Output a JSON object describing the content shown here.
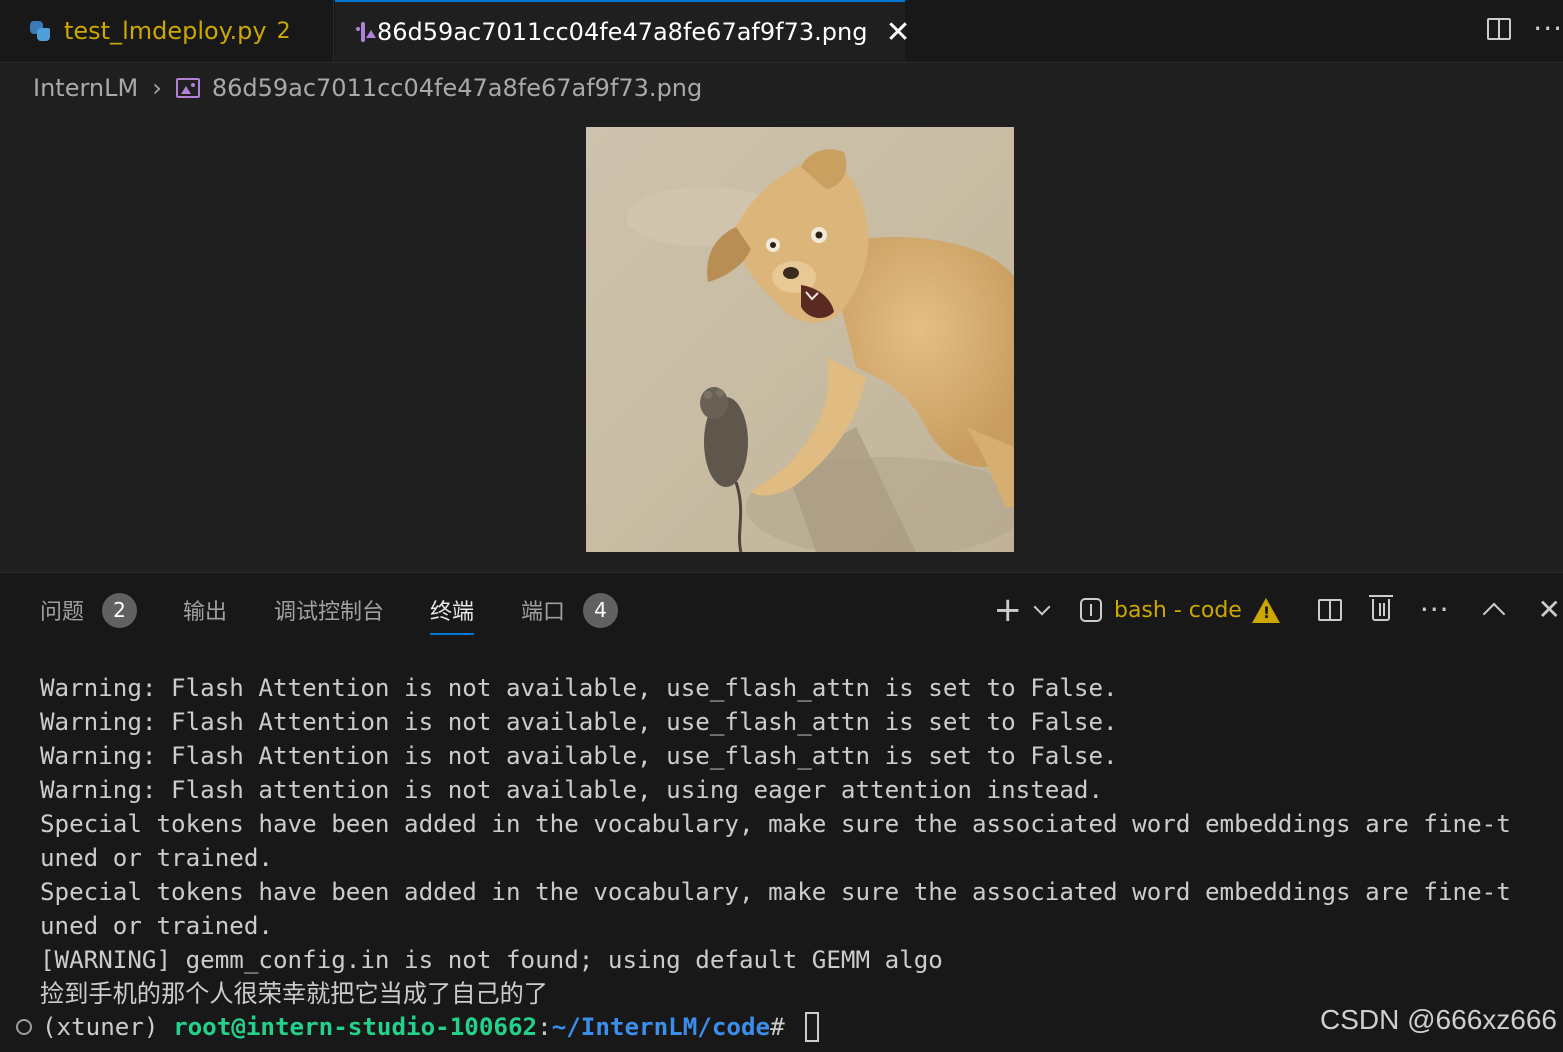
{
  "tabs": [
    {
      "label": "test_lmdeploy.py",
      "count": "2",
      "icon": "python-icon"
    },
    {
      "label": "86d59ac7011cc04fe47a8fe67af9f73.png",
      "icon": "image-icon"
    }
  ],
  "tab_close": "✕",
  "breadcrumb": {
    "folder": "InternLM",
    "file": "86d59ac7011cc04fe47a8fe67af9f73.png"
  },
  "preview": {
    "description_icon": "image-preview",
    "colors": {
      "sand": "#cbbfa6",
      "dog": "#d9b173",
      "rat": "#5e554b"
    }
  },
  "panel": {
    "tabs": [
      {
        "label": "问题",
        "badge": "2"
      },
      {
        "label": "输出"
      },
      {
        "label": "调试控制台"
      },
      {
        "label": "终端",
        "active": true
      },
      {
        "label": "端口",
        "badge": "4"
      }
    ],
    "terminal_name": "bash - code",
    "plus": "+",
    "more": "···",
    "close": "✕"
  },
  "terminal": {
    "lines": [
      "Warning: Flash Attention is not available, use_flash_attn is set to False.",
      "Warning: Flash Attention is not available, use_flash_attn is set to False.",
      "Warning: Flash Attention is not available, use_flash_attn is set to False.",
      "Warning: Flash attention is not available, using eager attention instead.",
      "Special tokens have been added in the vocabulary, make sure the associated word embeddings are fine-t",
      "uned or trained.",
      "Special tokens have been added in the vocabulary, make sure the associated word embeddings are fine-t",
      "uned or trained.",
      "[WARNING] gemm_config.in is not found; using default GEMM algo",
      "捡到手机的那个人很荣幸就把它当成了自己的了"
    ],
    "prompt": {
      "env": "(xtuner) ",
      "user": "root@intern-studio-100662",
      "sep": ":",
      "path": "~/InternLM/code",
      "suffix": "# "
    }
  },
  "watermark": "CSDN @666xz666",
  "colors": {
    "accent": "#0078d4",
    "warning": "#cca700",
    "prompt_user": "#23d18b",
    "prompt_path": "#3b8eea"
  }
}
